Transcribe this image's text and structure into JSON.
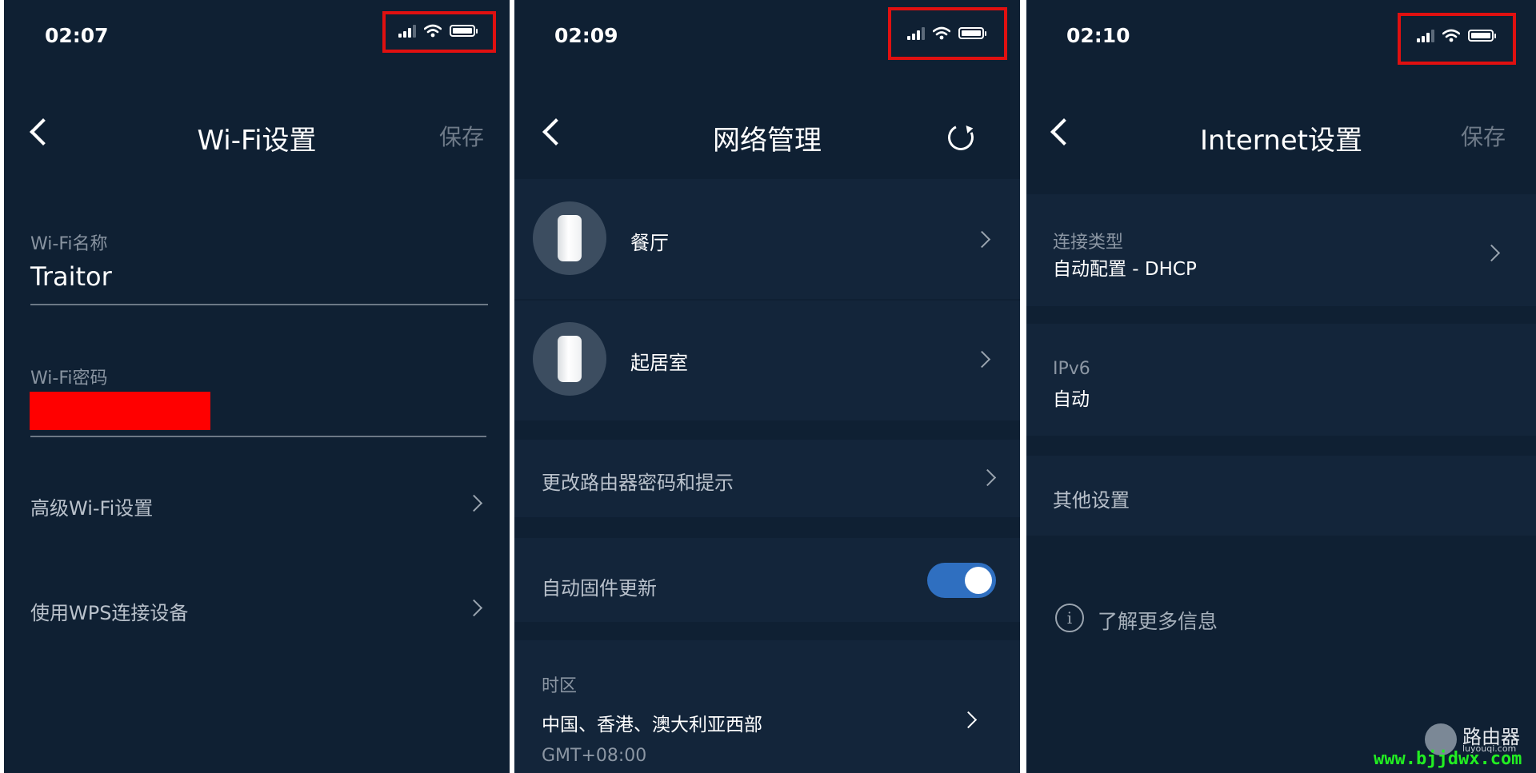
{
  "screens": [
    {
      "time": "02:07",
      "title": "Wi-Fi设置",
      "action": "保存",
      "wifi_name_label": "Wi-Fi名称",
      "wifi_name_value": "Traitor",
      "wifi_password_label": "Wi-Fi密码",
      "advanced_label": "高级Wi-Fi设置",
      "wps_label": "使用WPS连接设备"
    },
    {
      "time": "02:09",
      "title": "网络管理",
      "nodes": [
        {
          "name": "餐厅"
        },
        {
          "name": "起居室"
        }
      ],
      "change_password_label": "更改路由器密码和提示",
      "auto_firmware_label": "自动固件更新",
      "auto_firmware_on": true,
      "timezone_label": "时区",
      "timezone_value": "中国、香港、澳大利亚西部",
      "timezone_offset": "GMT+08:00"
    },
    {
      "time": "02:10",
      "title": "Internet设置",
      "action": "保存",
      "connection_type_label": "连接类型",
      "connection_type_value": "自动配置 - DHCP",
      "ipv6_label": "IPv6",
      "ipv6_value": "自动",
      "other_settings_label": "其他设置",
      "learn_more_label": "了解更多信息"
    }
  ],
  "watermark": {
    "title": "路由器",
    "sub": "luyouqi.com",
    "url": "www.bjjdwx.com"
  },
  "colors": {
    "background": "#0f2033",
    "row": "#13253a",
    "highlight_box": "#e01010",
    "toggle_on": "#2f6fc0",
    "redaction": "#ff0000"
  },
  "icons": [
    "signal-icon",
    "wifi-icon",
    "battery-icon",
    "back-chevron-icon",
    "chevron-right-icon",
    "refresh-icon",
    "router-node-icon",
    "info-icon"
  ]
}
